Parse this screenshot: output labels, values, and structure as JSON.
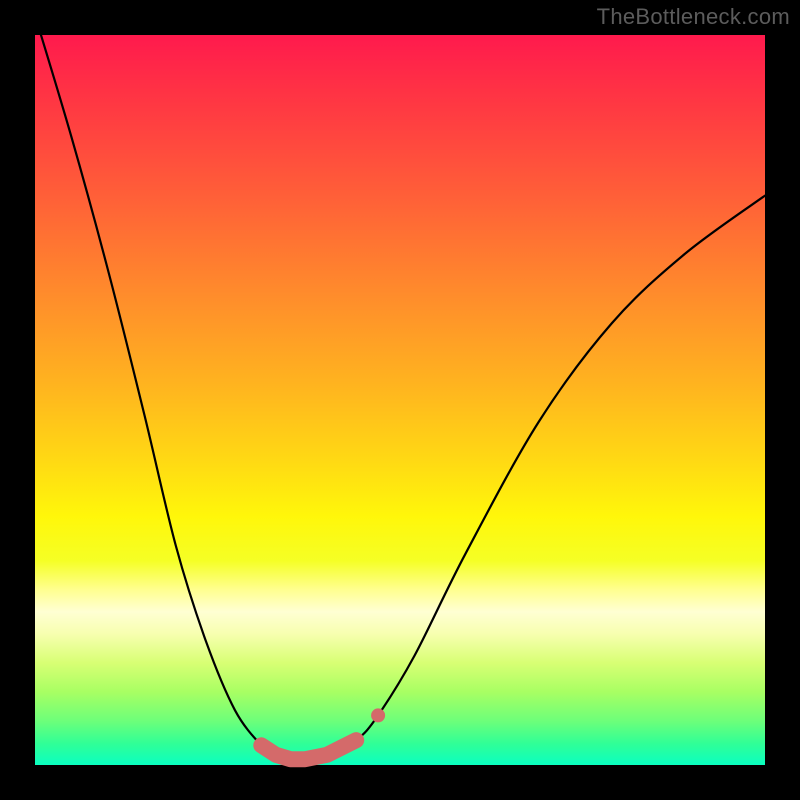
{
  "watermark": "TheBottleneck.com",
  "colors": {
    "frame": "#000000",
    "curve": "#000000",
    "markers": "#d46a6a"
  },
  "chart_data": {
    "type": "line",
    "title": "",
    "xlabel": "",
    "ylabel": "",
    "xlim": [
      0,
      1
    ],
    "ylim": [
      0,
      1
    ],
    "grid": false,
    "legend": false,
    "series": [
      {
        "name": "bottleneck-curve",
        "x": [
          0.0,
          0.05,
          0.1,
          0.15,
          0.193,
          0.234,
          0.274,
          0.31,
          0.33,
          0.35,
          0.37,
          0.4,
          0.44,
          0.47,
          0.52,
          0.59,
          0.69,
          0.79,
          0.89,
          1.0
        ],
        "y": [
          1.027,
          0.86,
          0.678,
          0.479,
          0.3,
          0.17,
          0.075,
          0.027,
          0.014,
          0.008,
          0.008,
          0.014,
          0.034,
          0.068,
          0.15,
          0.29,
          0.47,
          0.605,
          0.7,
          0.78
        ]
      }
    ],
    "markers": {
      "name": "trough-markers",
      "color": "#d46a6a",
      "points": [
        {
          "x": 0.31,
          "y": 0.027
        },
        {
          "x": 0.33,
          "y": 0.014
        },
        {
          "x": 0.35,
          "y": 0.008
        },
        {
          "x": 0.37,
          "y": 0.008
        },
        {
          "x": 0.4,
          "y": 0.014
        },
        {
          "x": 0.44,
          "y": 0.034
        }
      ],
      "extra_dot": {
        "x": 0.47,
        "y": 0.068
      }
    }
  }
}
